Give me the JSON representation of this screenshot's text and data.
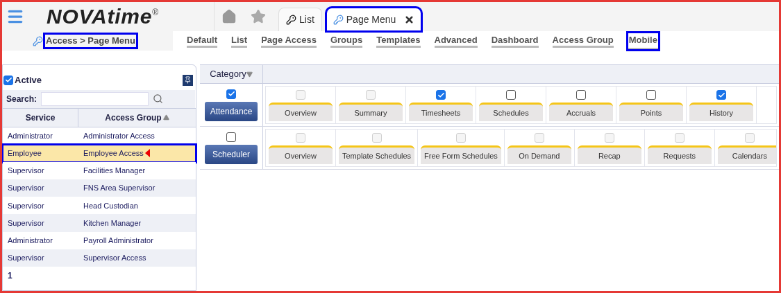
{
  "header": {
    "logo": "NOVAtime",
    "logo_mark": "®"
  },
  "tabs": [
    {
      "label": "List",
      "selected": false,
      "highlighted": false,
      "closable": false
    },
    {
      "label": "Page Menu",
      "selected": true,
      "highlighted": true,
      "closable": true
    }
  ],
  "breadcrumb": {
    "text": "Access > Page Menu",
    "highlighted": true
  },
  "nav": [
    {
      "label": "Default",
      "highlighted": false
    },
    {
      "label": "List",
      "highlighted": false
    },
    {
      "label": "Page Access",
      "highlighted": false
    },
    {
      "label": "Groups",
      "highlighted": false
    },
    {
      "label": "Templates",
      "highlighted": false
    },
    {
      "label": "Advanced",
      "highlighted": false
    },
    {
      "label": "Dashboard",
      "highlighted": false
    },
    {
      "label": "Access Group",
      "highlighted": false
    },
    {
      "label": "Mobile",
      "highlighted": true
    }
  ],
  "left_panel": {
    "active": {
      "label": "Active",
      "checked": true
    },
    "search_label": "Search:",
    "columns": [
      {
        "label": "Service",
        "sorted": false
      },
      {
        "label": "Access Group",
        "sorted": true
      }
    ],
    "rows": [
      {
        "service": "Administrator",
        "group": "Administrator Access",
        "selected": false
      },
      {
        "service": "Employee",
        "group": "Employee Access",
        "selected": true
      },
      {
        "service": "Supervisor",
        "group": "Facilities Manager",
        "selected": false
      },
      {
        "service": "Supervisor",
        "group": "FNS Area Supervisor",
        "selected": false
      },
      {
        "service": "Supervisor",
        "group": "Head Custodian",
        "selected": false
      },
      {
        "service": "Supervisor",
        "group": "Kitchen Manager",
        "selected": false
      },
      {
        "service": "Administrator",
        "group": "Payroll Administrator",
        "selected": false
      },
      {
        "service": "Supervisor",
        "group": "Supervisor Access",
        "selected": false
      }
    ],
    "pager": "1"
  },
  "grid": {
    "category_header": "Category",
    "categories": [
      {
        "name": "Attendance",
        "checked": true,
        "pages": [
          {
            "label": "Overview",
            "checked": false,
            "disabled": true
          },
          {
            "label": "Summary",
            "checked": false,
            "disabled": true
          },
          {
            "label": "Timesheets",
            "checked": true,
            "disabled": false
          },
          {
            "label": "Schedules",
            "checked": false,
            "disabled": false
          },
          {
            "label": "Accruals",
            "checked": false,
            "disabled": false
          },
          {
            "label": "Points",
            "checked": false,
            "disabled": false
          },
          {
            "label": "History",
            "checked": true,
            "disabled": false
          }
        ]
      },
      {
        "name": "Scheduler",
        "checked": false,
        "pages": [
          {
            "label": "Overview",
            "checked": false,
            "disabled": true
          },
          {
            "label": "Template Schedules",
            "checked": false,
            "disabled": true
          },
          {
            "label": "Free Form Schedules",
            "checked": false,
            "disabled": true
          },
          {
            "label": "On Demand",
            "checked": false,
            "disabled": true
          },
          {
            "label": "Recap",
            "checked": false,
            "disabled": true
          },
          {
            "label": "Requests",
            "checked": false,
            "disabled": true
          },
          {
            "label": "Calendars",
            "checked": false,
            "disabled": true
          }
        ]
      }
    ]
  }
}
